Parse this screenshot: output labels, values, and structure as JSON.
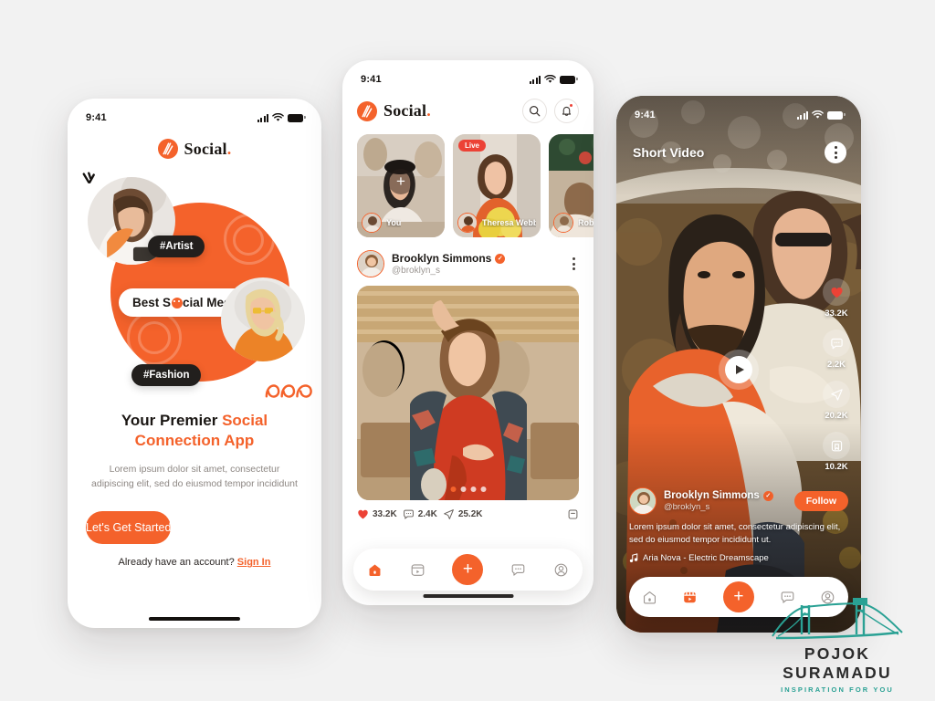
{
  "meta": {
    "accent_color": "#f4622b",
    "dark_color": "#221f1d",
    "background": "#f2f2f2",
    "live_red": "#ec4236"
  },
  "onboarding": {
    "status_time": "9:41",
    "brand_name": "Social",
    "brand_dot": ".",
    "chip_artist": "#Artist",
    "chip_fashion": "#Fashion",
    "pill_best_1": "Best S",
    "pill_best_2": "cial Media App",
    "headline_1": "Your Premier ",
    "headline_accent": "Social",
    "headline_2": "Connection App",
    "subtext": "Lorem ipsum dolor sit amet, consectetur adipiscing elit, sed do eiusmod tempor incididunt",
    "cta_label": "Let's Get Started",
    "account_text": "Already have an account? ",
    "signin_label": "Sign In"
  },
  "feed": {
    "status_time": "9:41",
    "brand_name": "Social",
    "brand_dot": ".",
    "search_icon": "search-icon",
    "bell_icon": "bell-icon",
    "stories": [
      {
        "name": "You",
        "live": false,
        "add": true
      },
      {
        "name": "Theresa Webb",
        "live": true,
        "add": false
      },
      {
        "name": "Rob",
        "live": false,
        "add": false
      }
    ],
    "live_label": "Live",
    "post": {
      "author": "Brooklyn Simmons",
      "handle": "@broklyn_s",
      "verified": true,
      "carousel_dots": 4,
      "carousel_active": 0,
      "stats": [
        {
          "icon": "heart-icon",
          "value": "33.2K"
        },
        {
          "icon": "comment-icon",
          "value": "2.4K"
        },
        {
          "icon": "share-icon",
          "value": "25.2K"
        },
        {
          "icon": "bookmark-icon",
          "value": ""
        }
      ]
    },
    "tabs": [
      {
        "name": "home",
        "icon": "home-icon",
        "active": true
      },
      {
        "name": "reels",
        "icon": "reels-icon",
        "active": false
      },
      {
        "name": "create",
        "icon": "plus-icon",
        "active": false
      },
      {
        "name": "messages",
        "icon": "chat-icon",
        "active": false
      },
      {
        "name": "profile",
        "icon": "person-icon",
        "active": false
      }
    ]
  },
  "shortvideo": {
    "status_time": "9:41",
    "title": "Short Video",
    "author": "Brooklyn Simmons",
    "handle": "@broklyn_s",
    "verified": true,
    "follow_label": "Follow",
    "caption": "Lorem ipsum dolor sit amet, consectetur adipiscing elit, sed do eiusmod tempor incididunt ut.",
    "music": "Aria Nova - Electric Dreamscape",
    "rail": [
      {
        "icon": "heart-icon",
        "value": "33.2K"
      },
      {
        "icon": "comment-icon",
        "value": "2.2K"
      },
      {
        "icon": "share-icon",
        "value": "20.2K"
      },
      {
        "icon": "bookmark-icon",
        "value": "10.2K"
      }
    ],
    "tabs": [
      {
        "name": "home",
        "icon": "home-icon",
        "active": false
      },
      {
        "name": "reels",
        "icon": "reels-icon",
        "active": true
      },
      {
        "name": "create",
        "icon": "plus-icon",
        "active": false
      },
      {
        "name": "messages",
        "icon": "chat-icon",
        "active": false
      },
      {
        "name": "profile",
        "icon": "person-icon",
        "active": false
      }
    ]
  },
  "watermark": {
    "name": "POJOK SURAMADU",
    "tagline": "INSPIRATION FOR YOU"
  }
}
